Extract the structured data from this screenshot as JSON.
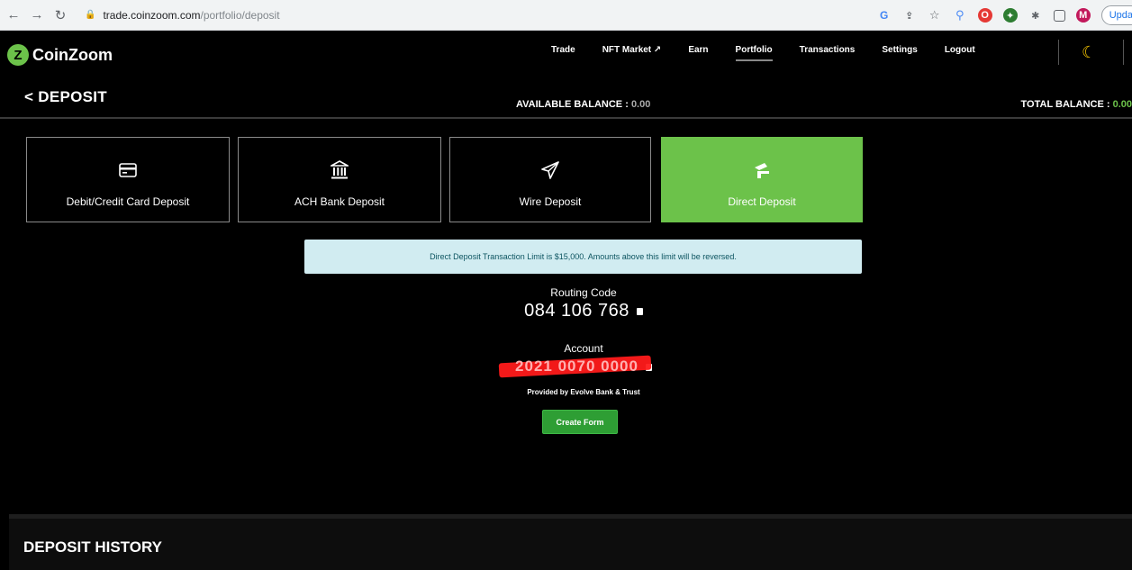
{
  "browser": {
    "url_host": "trade.coinzoom.com",
    "url_path": "/portfolio/deposit",
    "update_label": "Upda"
  },
  "app": {
    "logo_text": "CoinZoom",
    "nav": [
      {
        "label": "Trade"
      },
      {
        "label": "NFT Market ↗"
      },
      {
        "label": "Earn"
      },
      {
        "label": "Portfolio",
        "active": true
      },
      {
        "label": "Transactions"
      },
      {
        "label": "Settings"
      },
      {
        "label": "Logout"
      }
    ]
  },
  "header": {
    "title": "DEPOSIT",
    "available_label": "AVAILABLE BALANCE :",
    "available_value": "0.00",
    "total_label": "TOTAL BALANCE :",
    "total_value": "0.00"
  },
  "tiles": [
    {
      "label": "Debit/Credit Card Deposit",
      "icon": "credit-card-icon"
    },
    {
      "label": "ACH Bank Deposit",
      "icon": "bank-icon"
    },
    {
      "label": "Wire Deposit",
      "icon": "paper-plane-icon"
    },
    {
      "label": "Direct Deposit",
      "icon": "direct-deposit-icon",
      "active": true
    }
  ],
  "info": {
    "message": "Direct Deposit Transaction Limit is $15,000. Amounts above this limit will be reversed."
  },
  "routing": {
    "label": "Routing Code",
    "value": "084 106 768"
  },
  "account": {
    "label": "Account",
    "value": "2021 0070 0000",
    "provider": "Provided by Evolve Bank & Trust"
  },
  "create_form_label": "Create Form",
  "history_title": "DEPOSIT HISTORY",
  "colors": {
    "accent_green": "#6cc24a",
    "button_green": "#2e9e34",
    "info_bg": "#d1ecf1"
  }
}
